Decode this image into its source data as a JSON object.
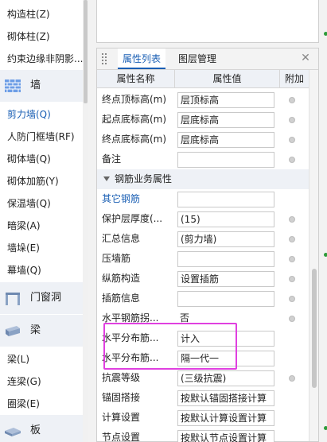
{
  "sidebar": {
    "items_top": [
      {
        "label": "构造柱(Z)"
      },
      {
        "label": "砌体柱(Z)"
      },
      {
        "label": "约束边缘非阴影..."
      }
    ],
    "group_wall": {
      "label": "墙",
      "icon": "wall-brick-icon"
    },
    "items_wall": [
      {
        "label": "剪力墙(Q)",
        "active": true
      },
      {
        "label": "人防门框墙(RF)"
      },
      {
        "label": "砌体墙(Q)"
      },
      {
        "label": "砌体加筋(Y)"
      },
      {
        "label": "保温墙(Q)"
      },
      {
        "label": "暗梁(A)"
      },
      {
        "label": "墙垛(E)"
      },
      {
        "label": "幕墙(Q)"
      }
    ],
    "group_door": {
      "label": "门窗洞",
      "icon": "door-window-icon"
    },
    "group_beam": {
      "label": "梁",
      "icon": "beam-icon"
    },
    "items_beam": [
      {
        "label": "梁(L)"
      },
      {
        "label": "连梁(G)"
      },
      {
        "label": "圈梁(E)"
      }
    ],
    "group_slab": {
      "label": "板",
      "icon": "slab-icon"
    }
  },
  "panel": {
    "tabs": [
      {
        "label": "属性列表",
        "active": true
      },
      {
        "label": "图层管理"
      }
    ],
    "close_symbol": "✕",
    "headers": {
      "name": "属性名称",
      "value": "属性值",
      "add": "附加"
    },
    "rows_top": [
      {
        "name": "终点顶标高(m)",
        "value": "层顶标高",
        "dot": true
      },
      {
        "name": "起点底标高(m)",
        "value": "层底标高",
        "dot": true
      },
      {
        "name": "终点底标高(m)",
        "value": "层底标高",
        "dot": true
      },
      {
        "name": "备注",
        "value": "",
        "dot": true
      }
    ],
    "section": {
      "label": "钢筋业务属性"
    },
    "rows_rebar": [
      {
        "name": "其它钢筋",
        "value": "",
        "dot": false,
        "blue": true
      },
      {
        "name": "保护层厚度(...",
        "value": "(15)",
        "dot": true
      },
      {
        "name": "汇总信息",
        "value": "(剪力墙)",
        "dot": true
      },
      {
        "name": "压墙筋",
        "value": "",
        "dot": true
      },
      {
        "name": "纵筋构造",
        "value": "设置插筋",
        "dot": true
      },
      {
        "name": "插筋信息",
        "value": "",
        "dot": true
      },
      {
        "name": "水平钢筋拐...",
        "value": "否",
        "dot": true,
        "plain": true
      },
      {
        "name": "水平分布筋...",
        "value": "计入",
        "dot": false
      },
      {
        "name": "水平分布筋...",
        "value": "隔一代一",
        "dot": false
      },
      {
        "name": "抗震等级",
        "value": "(三级抗震)",
        "dot": true
      },
      {
        "name": "锚固搭接",
        "value": "按默认锚固搭接计算",
        "dot": false
      },
      {
        "name": "计算设置",
        "value": "按默认计算设置计算",
        "dot": false
      },
      {
        "name": "节点设置",
        "value": "按默认节点设置计算",
        "dot": false
      }
    ]
  },
  "colors": {
    "accent": "#1a5fb4",
    "highlight": "#e040e0",
    "section_bg": "#eef1f6"
  }
}
